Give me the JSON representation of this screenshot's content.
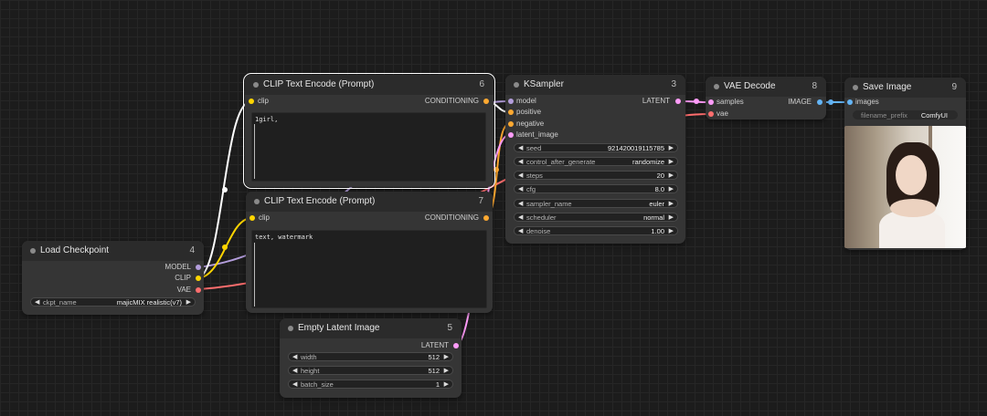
{
  "colors": {
    "canvas_bg": "#1c1c1c",
    "node_bg": "#353535",
    "node_header": "#2b2b2b",
    "model_wire": "#b39ddb",
    "clip_wire": "#ffd500",
    "vae_wire": "#ff6e6e",
    "conditioning_wire": "#ffa931",
    "latent_wire": "#ff9cf9",
    "image_wire": "#64b5f6"
  },
  "nodes": {
    "load_checkpoint": {
      "title": "Load Checkpoint",
      "id": "4",
      "outputs": [
        "MODEL",
        "CLIP",
        "VAE"
      ],
      "widgets": [
        {
          "label": "ckpt_name",
          "value": "majicMIX realistic(v7)"
        }
      ]
    },
    "clip_positive": {
      "title": "CLIP Text Encode (Prompt)",
      "id": "6",
      "input": "clip",
      "output": "CONDITIONING",
      "text": "1girl,"
    },
    "clip_negative": {
      "title": "CLIP Text Encode (Prompt)",
      "id": "7",
      "input": "clip",
      "output": "CONDITIONING",
      "text": "text, watermark"
    },
    "empty_latent": {
      "title": "Empty Latent Image",
      "id": "5",
      "output": "LATENT",
      "widgets": [
        {
          "label": "width",
          "value": "512"
        },
        {
          "label": "height",
          "value": "512"
        },
        {
          "label": "batch_size",
          "value": "1"
        }
      ]
    },
    "ksampler": {
      "title": "KSampler",
      "id": "3",
      "inputs": [
        "model",
        "positive",
        "negative",
        "latent_image"
      ],
      "output": "LATENT",
      "widgets": [
        {
          "label": "seed",
          "value": "921420019115785"
        },
        {
          "label": "control_after_generate",
          "value": "randomize"
        },
        {
          "label": "steps",
          "value": "20"
        },
        {
          "label": "cfg",
          "value": "8.0"
        },
        {
          "label": "sampler_name",
          "value": "euler"
        },
        {
          "label": "scheduler",
          "value": "normal"
        },
        {
          "label": "denoise",
          "value": "1.00"
        }
      ]
    },
    "vae_decode": {
      "title": "VAE Decode",
      "id": "8",
      "inputs": [
        "samples",
        "vae"
      ],
      "output": "IMAGE"
    },
    "save_image": {
      "title": "Save Image",
      "id": "9",
      "input": "images",
      "widgets": [
        {
          "label": "filename_prefix",
          "value": "ComfyUI"
        }
      ]
    }
  }
}
